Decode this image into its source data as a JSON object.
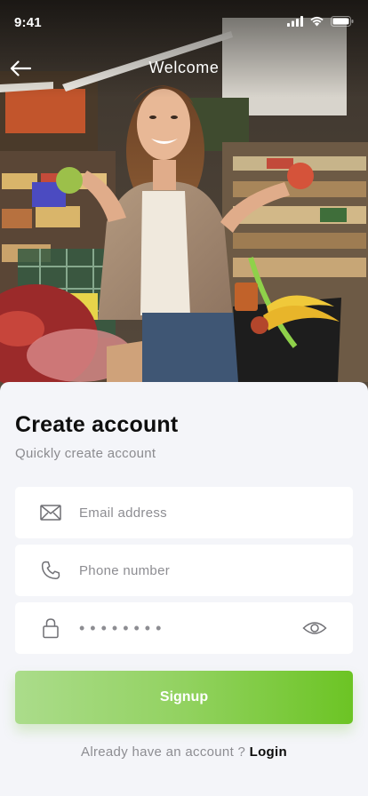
{
  "status_bar": {
    "time": "9:41"
  },
  "nav": {
    "title": "Welcome"
  },
  "form": {
    "title": "Create account",
    "subtitle": "Quickly create account",
    "email_placeholder": "Email address",
    "phone_placeholder": "Phone number",
    "password_masked": "••••••••",
    "signup_label": "Signup",
    "login_prompt": "Already have an account ?",
    "login_label": "Login"
  },
  "icons": {
    "back": "arrow-left-icon",
    "email": "envelope-icon",
    "phone": "phone-icon",
    "password": "lock-icon",
    "visibility": "eye-icon"
  },
  "colors": {
    "accent_start": "#abdc8b",
    "accent_end": "#6cc424",
    "background": "#f4f5f9",
    "field_bg": "#ffffff"
  }
}
